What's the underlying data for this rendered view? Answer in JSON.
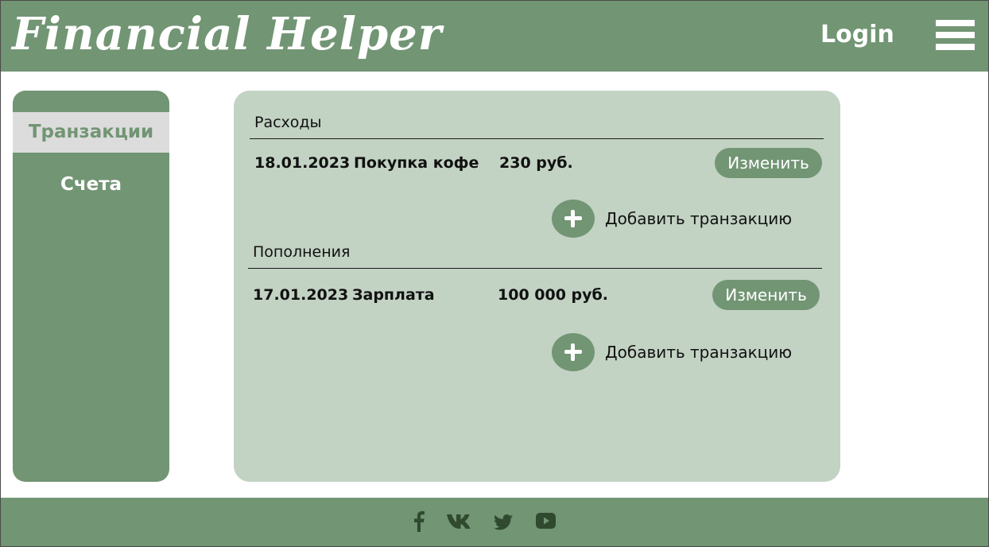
{
  "header": {
    "brand": "Financial Helper",
    "login_label": "Login",
    "menu_icon": "hamburger-menu-icon"
  },
  "sidebar": {
    "items": [
      {
        "label": "Транзакции",
        "active": true
      },
      {
        "label": "Счета",
        "active": false
      }
    ]
  },
  "main": {
    "sections": [
      {
        "title": "Расходы",
        "rows": [
          {
            "date": "18.01.2023",
            "name": "Покупка кофе",
            "amount": "230 руб.",
            "edit_label": "Изменить"
          }
        ],
        "add_label": "Добавить транзакцию"
      },
      {
        "title": "Пополнения",
        "rows": [
          {
            "date": "17.01.2023",
            "name": "Зарплата",
            "amount": "100 000 руб.",
            "edit_label": "Изменить"
          }
        ],
        "add_label": "Добавить транзакцию"
      }
    ]
  },
  "footer": {
    "social_icons": [
      "facebook-icon",
      "vk-icon",
      "twitter-icon",
      "youtube-icon"
    ]
  },
  "colors": {
    "accent": "#729574",
    "panel": "#c2d2c3",
    "active_tab_bg": "#dcdcdc",
    "footer_icon": "#2f4a2f"
  }
}
